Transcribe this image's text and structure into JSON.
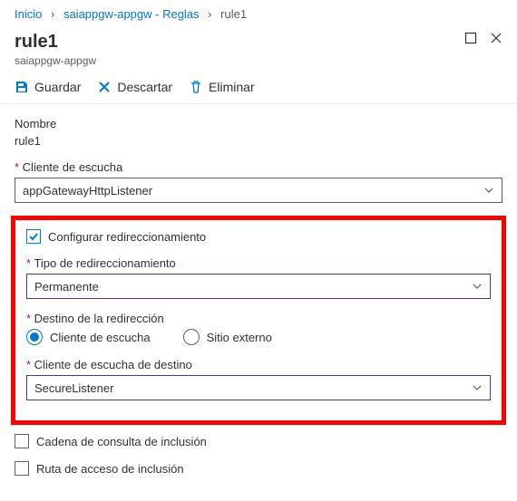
{
  "breadcrumb": {
    "home": "Inicio",
    "link": "saiappgw-appgw - Reglas",
    "current": "rule1"
  },
  "header": {
    "title": "rule1",
    "subtitle": "saiappgw-appgw"
  },
  "toolbar": {
    "save": "Guardar",
    "discard": "Descartar",
    "delete": "Eliminar"
  },
  "form": {
    "name_label": "Nombre",
    "name_value": "rule1",
    "listener_label": "Cliente de escucha",
    "listener_value": "appGatewayHttpListener",
    "configure_redirect_label": "Configurar redireccionamiento",
    "redirect_type_label": "Tipo de redireccionamiento",
    "redirect_type_value": "Permanente",
    "redirect_target_label": "Destino de la redirección",
    "target_option_listener": "Cliente de escucha",
    "target_option_external": "Sitio externo",
    "target_listener_label": "Cliente de escucha de destino",
    "target_listener_value": "SecureListener",
    "include_query_label": "Cadena de consulta de inclusión",
    "include_path_label": "Ruta de acceso de inclusión"
  }
}
